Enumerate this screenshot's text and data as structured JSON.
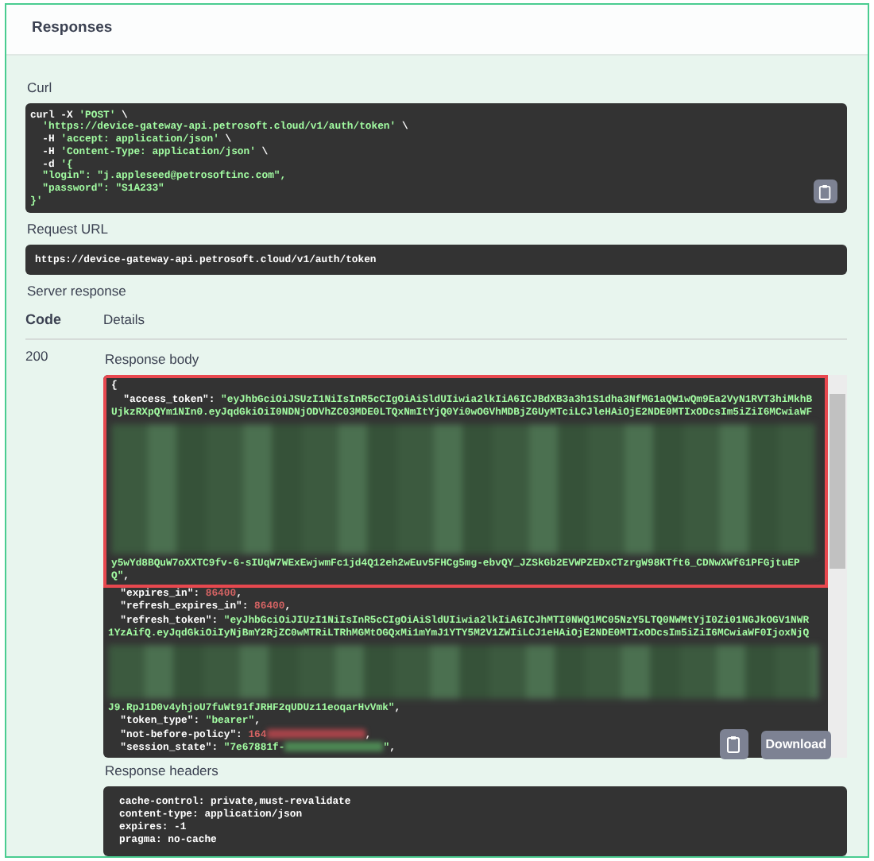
{
  "section_title": "Responses",
  "curl": {
    "label": "Curl",
    "lines": [
      [
        {
          "kind": "plain",
          "text": "curl -X "
        },
        {
          "kind": "string",
          "text": "'POST'"
        },
        {
          "kind": "plain",
          "text": " \\"
        }
      ],
      [
        {
          "kind": "string",
          "text": "  'https://device-gateway-api.petrosoft.cloud/v1/auth/token'"
        },
        {
          "kind": "plain",
          "text": " \\"
        }
      ],
      [
        {
          "kind": "plain",
          "text": "  -H "
        },
        {
          "kind": "string",
          "text": "'accept: application/json'"
        },
        {
          "kind": "plain",
          "text": " \\"
        }
      ],
      [
        {
          "kind": "plain",
          "text": "  -H "
        },
        {
          "kind": "string",
          "text": "'Content-Type: application/json'"
        },
        {
          "kind": "plain",
          "text": " \\"
        }
      ],
      [
        {
          "kind": "plain",
          "text": "  -d "
        },
        {
          "kind": "string",
          "text": "'{"
        }
      ],
      [
        {
          "kind": "string",
          "text": "  \"login\": \"j.appleseed@petrosoftinc.com\","
        }
      ],
      [
        {
          "kind": "string",
          "text": "  \"password\": \"S1A233\""
        }
      ],
      [
        {
          "kind": "string",
          "text": "}'"
        }
      ]
    ]
  },
  "request_url": {
    "label": "Request URL",
    "value": "https://device-gateway-api.petrosoft.cloud/v1/auth/token"
  },
  "server_response": {
    "label": "Server response",
    "columns": [
      "Code",
      "Details"
    ],
    "code": "200",
    "response_body": {
      "label": "Response body",
      "download_label": "Download",
      "blocks": [
        {
          "highlighted": true,
          "lines": [
            {
              "kind": "code",
              "parts": [
                {
                  "kind": "plain",
                  "text": "{"
                }
              ]
            },
            {
              "kind": "code",
              "parts": [
                {
                  "kind": "key",
                  "text": "  \"access_token\": "
                },
                {
                  "kind": "string",
                  "text": "\"eyJhbGciOiJSUzI1NiIsInR5cCIgOiAiSldUIiwia2lkIiA6ICJBdXB3a3h1S1dha3NfMG1aQW1wQm9Ea2VyN1RVT3hiMkhB"
                }
              ]
            },
            {
              "kind": "code",
              "parts": [
                {
                  "kind": "string",
                  "text": "UjkzRXpQYm1NIn0.eyJqdGkiOiI0NDNjODVhZC03MDE0LTQxNmItYjQ0Yi0wOGVhMDBjZGUyMTciLCJleHAiOjE2NDE0MTIxODcsIm5iZiI6MCwiaWF"
                }
              ]
            },
            {
              "kind": "redacted"
            },
            {
              "kind": "code",
              "parts": [
                {
                  "kind": "string",
                  "text": "y5wYd8BQuW7oXXTC9fv-6-sIUqW7WExEwjwmFc1jd4Q12eh2wEuv5FHCg5mg-ebvQY_JZSkGb2EVWPZEDxCTzrgW98KTft6_CDNwXWfG1PFGjtuEP"
                }
              ]
            },
            {
              "kind": "code",
              "parts": [
                {
                  "kind": "string",
                  "text": "Q\""
                },
                {
                  "kind": "plain",
                  "text": ","
                }
              ]
            }
          ]
        },
        {
          "highlighted": false,
          "lines": [
            {
              "kind": "code",
              "parts": [
                {
                  "kind": "key",
                  "text": "  \"expires_in\": "
                },
                {
                  "kind": "number",
                  "text": "86400"
                },
                {
                  "kind": "plain",
                  "text": ","
                }
              ]
            },
            {
              "kind": "code",
              "parts": [
                {
                  "kind": "key",
                  "text": "  \"refresh_expires_in\": "
                },
                {
                  "kind": "number",
                  "text": "86400"
                },
                {
                  "kind": "plain",
                  "text": ","
                }
              ]
            },
            {
              "kind": "code",
              "parts": [
                {
                  "kind": "key",
                  "text": "  \"refresh_token\": "
                },
                {
                  "kind": "string",
                  "text": "\"eyJhbGciOiJIUzI1NiIsInR5cCIgOiAiSldUIiwia2lkIiA6ICJhMTI0NWQ1MC05NzY5LTQ0NWMtYjI0Zi01NGJkOGV1NWR"
                }
              ]
            },
            {
              "kind": "code",
              "parts": [
                {
                  "kind": "string",
                  "text": "1YzAifQ.eyJqdGkiOiIyNjBmY2RjZC0wMTRiLTRhMGMtOGQxMi1mYmJ1YTY5M2V1ZWIiLCJ1eHAiOjE2NDE0MTIxODcsIm5iZiI6MCwiaWF0IjoxNjQ"
                }
              ]
            },
            {
              "kind": "redacted"
            },
            {
              "kind": "code",
              "parts": [
                {
                  "kind": "string",
                  "text": "J9.RpJ1D0v4yhjoU7fuWt91fJRHF2qUDUz11eoqarHvVmk\""
                },
                {
                  "kind": "plain",
                  "text": ","
                }
              ]
            },
            {
              "kind": "code",
              "parts": [
                {
                  "kind": "key",
                  "text": "  \"token_type\": "
                },
                {
                  "kind": "string",
                  "text": "\"bearer\""
                },
                {
                  "kind": "plain",
                  "text": ","
                }
              ]
            },
            {
              "kind": "code",
              "parts": [
                {
                  "kind": "key",
                  "text": "  \"not-before-policy\": "
                },
                {
                  "kind": "number",
                  "text": "164"
                },
                {
                  "kind": "redacted_number"
                },
                {
                  "kind": "plain",
                  "text": ","
                }
              ]
            },
            {
              "kind": "code",
              "parts": [
                {
                  "kind": "key",
                  "text": "  \"session_state\": "
                },
                {
                  "kind": "string",
                  "text": "\"7e67881f-"
                },
                {
                  "kind": "redacted_string"
                },
                {
                  "kind": "string",
                  "text": "\""
                },
                {
                  "kind": "plain",
                  "text": ","
                }
              ]
            }
          ]
        }
      ]
    },
    "response_headers": {
      "label": "Response headers",
      "lines": [
        "cache-control: private,must-revalidate",
        "content-type: application/json",
        "expires: -1",
        "pragma: no-cache"
      ]
    }
  }
}
